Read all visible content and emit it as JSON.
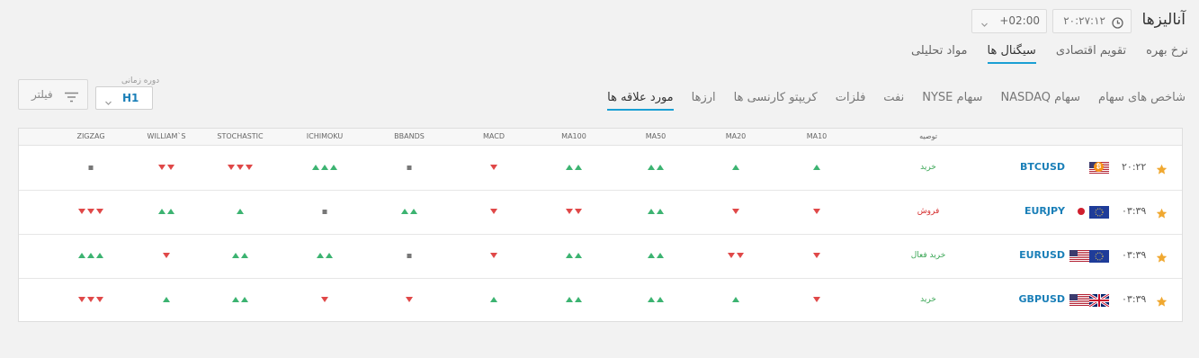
{
  "header": {
    "title": "آنالیزها",
    "time": "۲۰:۲۷:۱۲",
    "timezone": "+02:00",
    "clock_icon": "clock-icon",
    "dropdown_icon": "chevron-down-icon"
  },
  "main_tabs": [
    {
      "label": "مواد تحلیلی",
      "active": false
    },
    {
      "label": "سیگنال ها",
      "active": true
    },
    {
      "label": "تقویم اقتصادی",
      "active": false
    },
    {
      "label": "نرخ بهره",
      "active": false
    }
  ],
  "filters": {
    "period_label": "دوره زمانی",
    "period_value": "H1",
    "filter_label": "فیلتر",
    "filter_icon": "filter-icon"
  },
  "sub_tabs": [
    {
      "label": "مورد علاقه ها",
      "active": true
    },
    {
      "label": "ارزها",
      "active": false
    },
    {
      "label": "کریپتو کارنسی ها",
      "active": false
    },
    {
      "label": "فلزات",
      "active": false
    },
    {
      "label": "نفت",
      "active": false
    },
    {
      "label": "سهام NYSE",
      "active": false
    },
    {
      "label": "سهام NASDAQ",
      "active": false
    },
    {
      "label": "شاخص های سهام",
      "active": false
    }
  ],
  "table": {
    "columns": [
      "توصیه",
      "MA10",
      "MA20",
      "MA50",
      "MA100",
      "MACD",
      "BBANDS",
      "ICHIMOKU",
      "STOCHASTIC",
      "WILLIAM`S",
      "ZIGZAG"
    ],
    "rows": [
      {
        "time": "۲۰:۲۲",
        "symbol": "BTCUSD",
        "flags": [
          "us",
          "btc"
        ],
        "recommendation": "خرید",
        "rec_type": "buy",
        "signals": [
          "U",
          "U",
          "UU",
          "UU",
          "D",
          "N",
          "UUU",
          "DDD",
          "DD",
          "N"
        ]
      },
      {
        "time": "۰۳:۳۹",
        "symbol": "EURJPY",
        "flags": [
          "eu",
          "jp"
        ],
        "recommendation": "فروش",
        "rec_type": "sell",
        "signals": [
          "D",
          "D",
          "UU",
          "DD",
          "D",
          "UU",
          "N",
          "U",
          "UU",
          "DDD"
        ]
      },
      {
        "time": "۰۳:۳۹",
        "symbol": "EURUSD",
        "flags": [
          "eu",
          "us"
        ],
        "recommendation": "خرید فعال",
        "rec_type": "buy",
        "signals": [
          "D",
          "DD",
          "UU",
          "UU",
          "D",
          "N",
          "UU",
          "UU",
          "D",
          "UUU"
        ]
      },
      {
        "time": "۰۳:۳۹",
        "symbol": "GBPUSD",
        "flags": [
          "uk",
          "us"
        ],
        "recommendation": "خرید",
        "rec_type": "buy",
        "signals": [
          "D",
          "U",
          "UU",
          "UU",
          "U",
          "D",
          "D",
          "UU",
          "U",
          "DDD"
        ]
      }
    ]
  },
  "colors": {
    "accent": "#1a9fd4",
    "symbol": "#1a7fb8",
    "up": "#3cb371",
    "down": "#e04848",
    "neutral": "#777777",
    "star": "#f0a830"
  }
}
